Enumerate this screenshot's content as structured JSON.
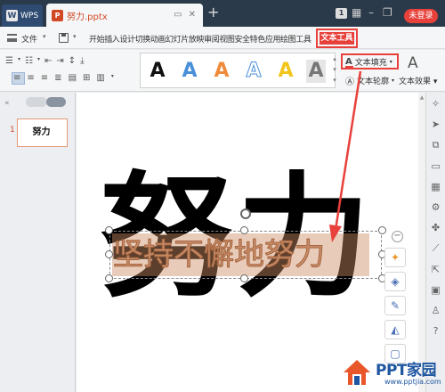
{
  "titlebar": {
    "wps_label": "WPS",
    "doc_tab_label": "努力.pptx",
    "badge": "1",
    "login_label": "未登录"
  },
  "menubar": {
    "file_label": "文件",
    "items": [
      "开始",
      "插入",
      "设计",
      "切换",
      "动画",
      "幻灯片放映",
      "审阅",
      "视图",
      "安全",
      "特色应用",
      "绘图工具"
    ],
    "text_tool_tab": "文本工具",
    "find_label": "查找"
  },
  "ribbon": {
    "style_letter": "A",
    "style_colors": [
      "#111111",
      "#4a90d9",
      "#ef8c3b",
      "#f5f5f5",
      "#f2c51d",
      "#9a9a9a"
    ],
    "text_fill_label": "文本填充",
    "text_outline_label": "文本轮廓",
    "text_effect_label": "文本效果"
  },
  "left_panel": {
    "slide_number": "1",
    "thumb_text": "努力"
  },
  "slide": {
    "big_text": "努力",
    "overlay_text": "坚持不懈地努力",
    "overlay_color": "#c98d6b"
  },
  "watermark": {
    "title": "PPT家园",
    "url": "www.pptjia.com"
  },
  "colors": {
    "accent_red": "#e8413b",
    "titlebar": "#2b3a4a",
    "pptx_orange": "#d24726"
  }
}
